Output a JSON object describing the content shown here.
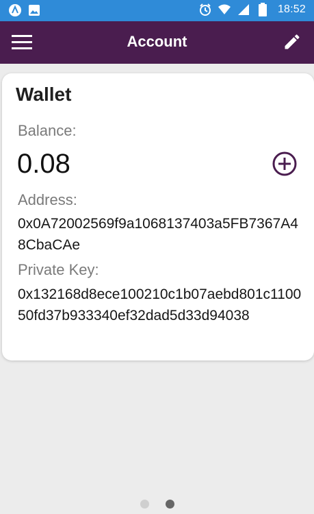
{
  "status_bar": {
    "time": "18:52",
    "left_icons": [
      "app-a-icon",
      "image-icon"
    ],
    "right_icons": [
      "alarm-icon",
      "wifi-icon",
      "signal-icon",
      "battery-icon"
    ]
  },
  "app_bar": {
    "title": "Account",
    "left_icon": "hamburger-menu-icon",
    "right_icon": "pencil-edit-icon",
    "bg_color": "#4a1d4f"
  },
  "wallet_card": {
    "title": "Wallet",
    "balance_label": "Balance:",
    "balance_value": "0.08",
    "add_icon": "plus-circle-icon",
    "address_label": "Address:",
    "address_value": "0x0A72002569f9a1068137403a5FB7367A48CbaCAe",
    "private_key_label": "Private Key:",
    "private_key_value": "0x132168d8ece100210c1b07aebd801c110050fd37b933340ef32dad5d33d94038"
  },
  "pager": {
    "pages": 2,
    "active_index": 1
  },
  "colors": {
    "status_bar": "#2f8bd8",
    "accent": "#4a1d4f",
    "background": "#ececec"
  }
}
